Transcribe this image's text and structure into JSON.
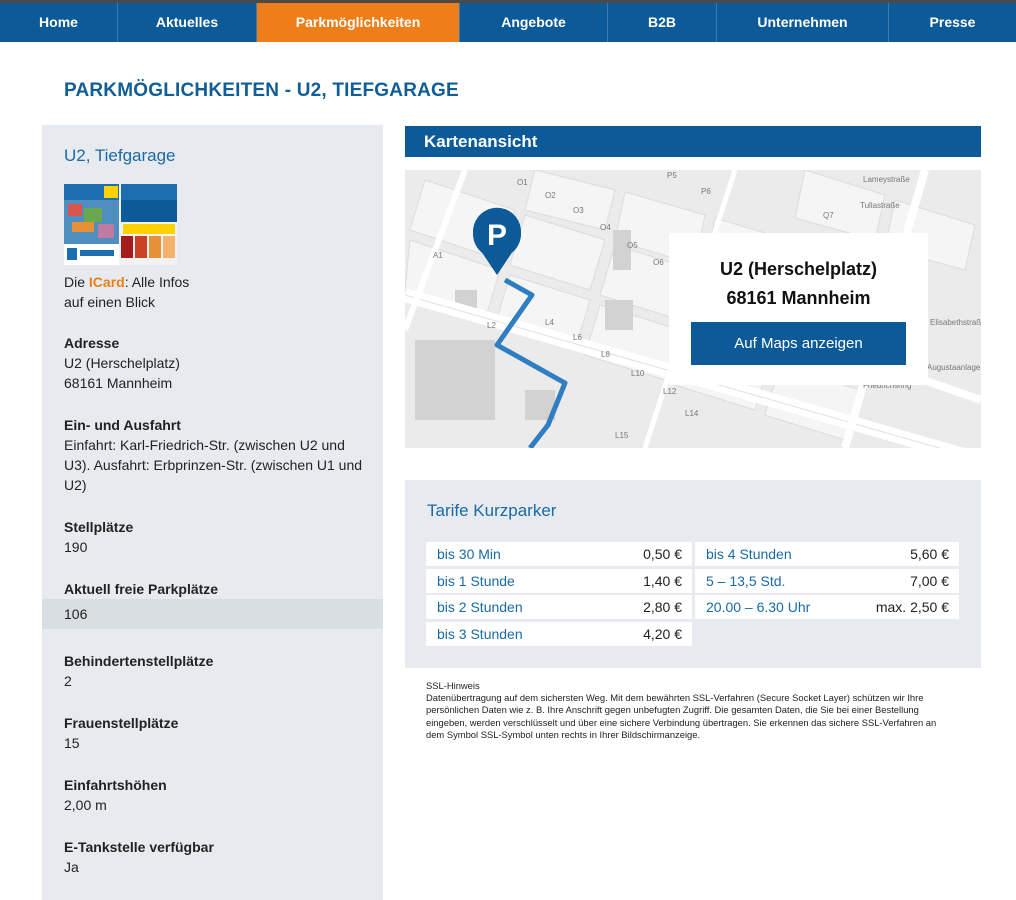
{
  "nav": {
    "items": [
      {
        "label": "Home"
      },
      {
        "label": "Aktuelles"
      },
      {
        "label": "Parkmöglichkeiten"
      },
      {
        "label": "Angebote"
      },
      {
        "label": "B2B"
      },
      {
        "label": "Unternehmen"
      },
      {
        "label": "Presse"
      }
    ],
    "active_index": 2,
    "active_color": "#ee7e1a",
    "bar_color": "#0c5a97"
  },
  "page_title": "PARKMÖGLICHKEITEN - U2, TIEFGARAGE",
  "sidebar": {
    "title": "U2, Tiefgarage",
    "icard": {
      "prefix": "Die ",
      "link": "ICard",
      "suffix": ": Alle Infos",
      "line2": "auf einen Blick"
    },
    "sections": [
      {
        "label": "Adresse",
        "lines": [
          "U2 (Herschelplatz)",
          "68161 Mannheim"
        ]
      },
      {
        "label": "Ein- und Ausfahrt",
        "lines": [
          "Einfahrt: Karl-Friedrich-Str. (zwischen U2 und",
          "U3). Ausfahrt: Erbprinzen-Str. (zwischen U1 und",
          "U2)"
        ]
      },
      {
        "label": "Stellplätze",
        "lines": [
          "190"
        ]
      },
      {
        "label": "Aktuell freie Parkplätze",
        "lines": [
          "106"
        ]
      },
      {
        "label": "Behindertenstellplätze",
        "lines": [
          "2"
        ]
      },
      {
        "label": "Frauenstellplätze",
        "lines": [
          "15"
        ]
      },
      {
        "label": "Einfahrtshöhen",
        "lines": [
          "2,00 m"
        ]
      },
      {
        "label": "E-Tankstelle verfügbar",
        "lines": [
          "Ja"
        ]
      }
    ]
  },
  "map": {
    "heading": "Kartenansicht",
    "card_line1": "U2 (Herschelplatz)",
    "card_line2": "68161 Mannheim",
    "button": "Auf Maps anzeigen",
    "pin_letter": "P",
    "street_labels": [
      "O1",
      "O2",
      "O3",
      "O4",
      "O5",
      "O6",
      "P5",
      "P6",
      "Q7",
      "A1",
      "L2",
      "L4",
      "L6",
      "L8",
      "L10",
      "L12",
      "L14",
      "L15",
      "Lameystraße",
      "Tullastraße",
      "Elisabethstraße",
      "Augustaanlage",
      "Friedrichsring"
    ]
  },
  "tarife": {
    "title": "Tarife Kurzparker",
    "left": [
      {
        "k": "bis 30 Min",
        "v": "0,50 €"
      },
      {
        "k": "bis 1 Stunde",
        "v": "1,40 €"
      },
      {
        "k": "bis 2 Stunden",
        "v": "2,80 €"
      },
      {
        "k": "bis 3 Stunden",
        "v": "4,20 €"
      }
    ],
    "right": [
      {
        "k": "bis 4 Stunden",
        "v": "5,60 €"
      },
      {
        "k": "5 – 13,5 Std.",
        "v": "7,00 €"
      },
      {
        "k": "20.00 – 6.30 Uhr",
        "v": "max. 2,50 €"
      }
    ]
  },
  "ssl": {
    "title": "SSL-Hinweis",
    "text": "Datenübertragung auf dem sichersten Weg. Mit dem bewährten SSL-Verfahren (Secure Socket Layer) schützen wir Ihre persönlichen Daten wie z. B. Ihre Anschrift gegen unbefugten Zugriff. Die gesamten Daten, die Sie bei einer Bestellung eingeben, werden verschlüsselt und über eine sichere Verbindung übertragen. Sie erkennen das sichere SSL-Verfahren an dem Symbol SSL-Symbol unten rechts in Ihrer Bildschirmanzeige."
  }
}
